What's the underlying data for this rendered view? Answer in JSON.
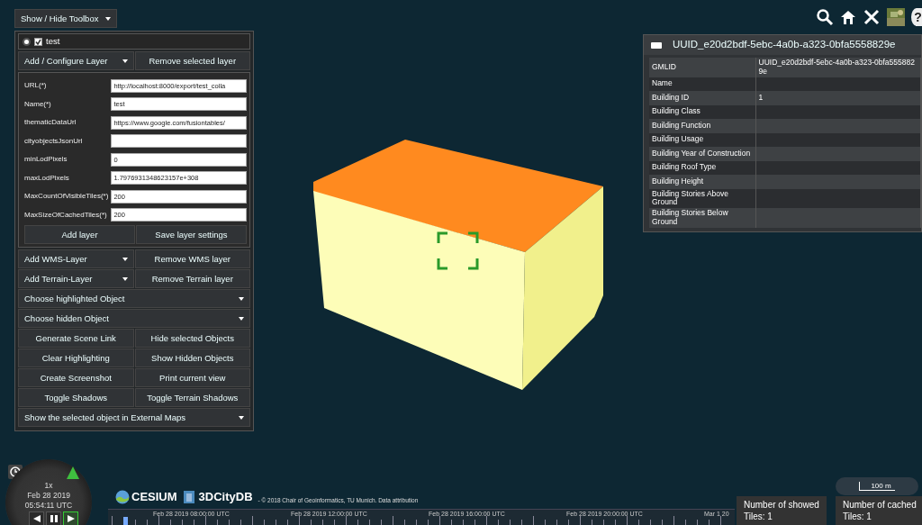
{
  "toolbox": {
    "toggle_label": "Show / Hide Toolbox",
    "layers": [
      {
        "name": "test",
        "selected": true,
        "checked": true
      }
    ],
    "layer_menu": {
      "kind": "dropdown-pair",
      "left": "Add / Configure Layer",
      "right": "Remove selected layer"
    },
    "layer_form": {
      "fields": [
        {
          "label": "URL(*)",
          "value": "http://localhost:8000/export/test_colla"
        },
        {
          "label": "Name(*)",
          "value": "test"
        },
        {
          "label": "thematicDataUrl",
          "value": "https://www.google.com/fusiontables/"
        },
        {
          "label": "cityobjectsJsonUrl"
        },
        {
          "label": "minLodPixels",
          "value": "0"
        },
        {
          "label": "maxLodPixels",
          "value": "1.7976931348623157e+308"
        },
        {
          "label": "MaxCountOfVisibleTiles(*)",
          "value": "200"
        },
        {
          "label": "MaxSizeOfCachedTiles(*)",
          "value": "200"
        }
      ],
      "buttons": [
        "Add layer",
        "Save layer settings"
      ]
    },
    "rows": [
      {
        "kind": "dropdown-pair",
        "left": "Add WMS-Layer",
        "right": "Remove WMS layer"
      },
      {
        "kind": "dropdown-pair",
        "left": "Add Terrain-Layer",
        "right": "Remove Terrain layer"
      },
      {
        "kind": "dropdown",
        "left": "Choose highlighted Object"
      },
      {
        "kind": "dropdown",
        "left": "Choose hidden Object"
      },
      {
        "kind": "pair",
        "left": "Generate Scene Link",
        "right": "Hide selected Objects"
      },
      {
        "kind": "pair",
        "left": "Clear Highlighting",
        "right": "Show Hidden Objects"
      },
      {
        "kind": "pair",
        "left": "Create Screenshot",
        "right": "Print current view"
      },
      {
        "kind": "pair",
        "left": "Toggle Shadows",
        "right": "Toggle Terrain Shadows"
      },
      {
        "kind": "dropdown",
        "left": "Show the selected object in External Maps"
      }
    ]
  },
  "toolbar": {
    "help_label": "?"
  },
  "info_box": {
    "title": "UUID_e20d2bdf-5ebc-4a0b-a323-0bfa5558829e",
    "rows": [
      {
        "label": "GMLID",
        "value": "UUID_e20d2bdf-5ebc-4a0b-a323-0bfa5558829e"
      },
      {
        "label": "Name"
      },
      {
        "label": "Building ID",
        "value": "1"
      },
      {
        "label": "Building Class"
      },
      {
        "label": "Building Function"
      },
      {
        "label": "Building Usage"
      },
      {
        "label": "Building Year of Construction"
      },
      {
        "label": "Building Roof Type"
      },
      {
        "label": "Building Height"
      },
      {
        "label": "Building Stories Above Ground"
      },
      {
        "label": "Building Stories Below Ground"
      }
    ]
  },
  "clock": {
    "speed": "1x",
    "date": "Feb 28 2019",
    "time": "05:54:11 UTC",
    "buttons": [
      {
        "kind": "reverse",
        "selected": false
      },
      {
        "kind": "pause",
        "selected": false
      },
      {
        "kind": "play",
        "selected": true
      }
    ]
  },
  "credits": {
    "logos": [
      {
        "kind": "cesium",
        "label": "CESIUM"
      },
      {
        "kind": "citydb",
        "label": "3DCityDB"
      }
    ],
    "text": "- © 2018 Chair of Geoinformatics, TU Munich. Data attribution"
  },
  "timeline": {
    "labels": [
      "Feb 28 2019 08:00:00 UTC",
      "Feb 28 2019 12:00:00 UTC",
      "Feb 28 2019 16:00:00 UTC",
      "Feb 28 2019 20:00:00 UTC",
      "Mar 1 20"
    ]
  },
  "distance_legend": {
    "label": "100 m"
  },
  "stats": [
    {
      "text": "Number of showed Tiles: 1"
    },
    {
      "text": "Number of cached Tiles: 1"
    }
  ]
}
